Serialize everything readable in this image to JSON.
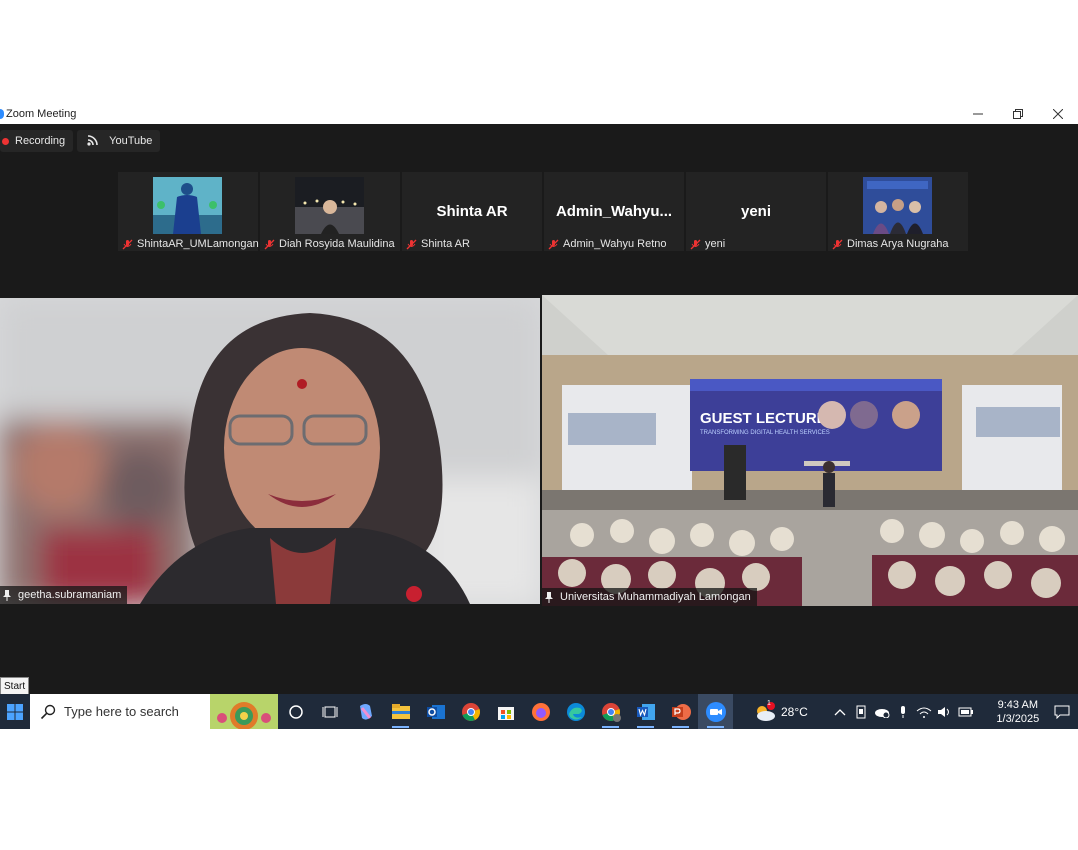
{
  "window": {
    "title": "Zoom Meeting",
    "minimize_icon": "minimize-icon",
    "restore_icon": "restore-icon",
    "close_icon": "close-icon"
  },
  "toolbar": {
    "recording_label": "Recording",
    "stream_label": "YouTube"
  },
  "participants": [
    {
      "tile_name": "",
      "label": "ShintaAR_UMLamongan",
      "video": true
    },
    {
      "tile_name": "",
      "label": "Diah Rosyida Maulidina",
      "video": true
    },
    {
      "tile_name": "Shinta AR",
      "label": "Shinta AR",
      "video": false
    },
    {
      "tile_name": "Admin_Wahyu...",
      "label": "Admin_Wahyu Retno",
      "video": false
    },
    {
      "tile_name": "yeni",
      "label": "yeni",
      "video": false
    },
    {
      "tile_name": "",
      "label": "Dimas Arya Nugraha",
      "video": true
    }
  ],
  "main_videos": [
    {
      "label": "geetha.subramaniam"
    },
    {
      "label": "Universitas Muhammadiyah Lamongan",
      "slide_title": "GUEST LECTURE",
      "slide_subtitle": "TRANSFORMING DIGITAL HEALTH SERVICES"
    }
  ],
  "start_tooltip": "Start",
  "taskbar": {
    "search_placeholder": "Type here to search",
    "weather_temp": "28°C",
    "weather_badge": "1",
    "time": "9:43 AM",
    "date": "1/3/2025"
  },
  "colors": {
    "meeting_bg": "#1a1a1a",
    "active_speaker_border": "#dff07a",
    "taskbar_bg": "#1f2a3a",
    "recording_dot": "#e33333"
  }
}
